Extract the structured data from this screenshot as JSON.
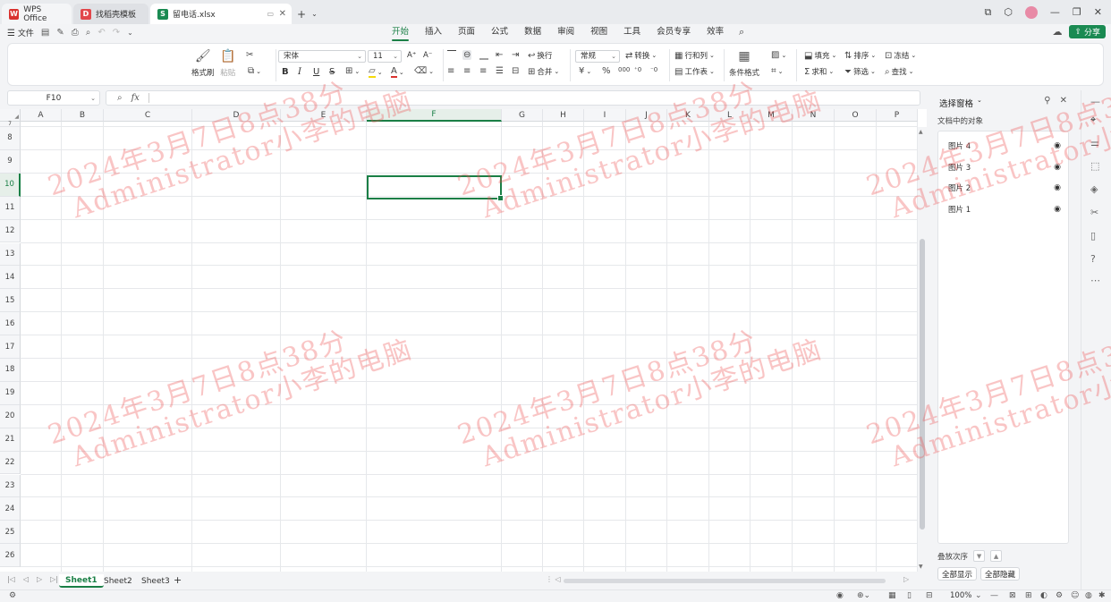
{
  "tabs": {
    "wps": "WPS Office",
    "template": "找稻壳模板",
    "file": "留电话.xlsx"
  },
  "menu": {
    "file": "文件",
    "tabs": [
      "开始",
      "插入",
      "页面",
      "公式",
      "数据",
      "审阅",
      "视图",
      "工具",
      "会员专享",
      "效率"
    ],
    "active_tab": "开始",
    "share": "分享"
  },
  "ribbon": {
    "format_painter": "格式刷",
    "paste": "粘贴",
    "font_name": "宋体",
    "font_size": "11",
    "bold": "B",
    "italic": "I",
    "underline": "U",
    "strike": "S",
    "wrap": "换行",
    "merge": "合并",
    "number_format": "常规",
    "convert": "转换",
    "rows_cols": "行和列",
    "worksheet": "工作表",
    "cond_format": "条件格式",
    "fill": "填充",
    "sort": "排序",
    "freeze": "冻结",
    "sum": "求和",
    "filter": "筛选",
    "find": "查找"
  },
  "formula_bar": {
    "cell_ref": "F10",
    "fx": "fx"
  },
  "grid": {
    "columns": [
      "A",
      "B",
      "C",
      "D",
      "E",
      "F",
      "G",
      "H",
      "I",
      "J",
      "K",
      "L",
      "M",
      "N",
      "O",
      "P"
    ],
    "rows": [
      "7",
      "8",
      "9",
      "10",
      "11",
      "12",
      "13",
      "14",
      "15",
      "16",
      "17",
      "18",
      "19",
      "20",
      "21",
      "22",
      "23",
      "24",
      "25",
      "26"
    ],
    "active_column": "F",
    "active_row": "10"
  },
  "sheets": [
    "Sheet1",
    "Sheet2",
    "Sheet3"
  ],
  "active_sheet": "Sheet1",
  "status": {
    "zoom": "100%"
  },
  "panel": {
    "title": "选择窗格",
    "subtitle": "文档中的对象",
    "objects": [
      "图片 4",
      "图片 3",
      "图片 2",
      "图片 1"
    ],
    "stack_order": "叠放次序",
    "show_all": "全部显示",
    "hide_all": "全部隐藏"
  },
  "watermark": {
    "line1": "2024年3月7日8点38分",
    "line2": "Administrator小李的电脑"
  },
  "colors": {
    "accent": "#1a7f46",
    "share_button": "#1a8a52",
    "watermark": "#eb4b4b"
  },
  "icons": {
    "eye": "eye-icon",
    "search": "search-icon",
    "close": "close-icon"
  }
}
